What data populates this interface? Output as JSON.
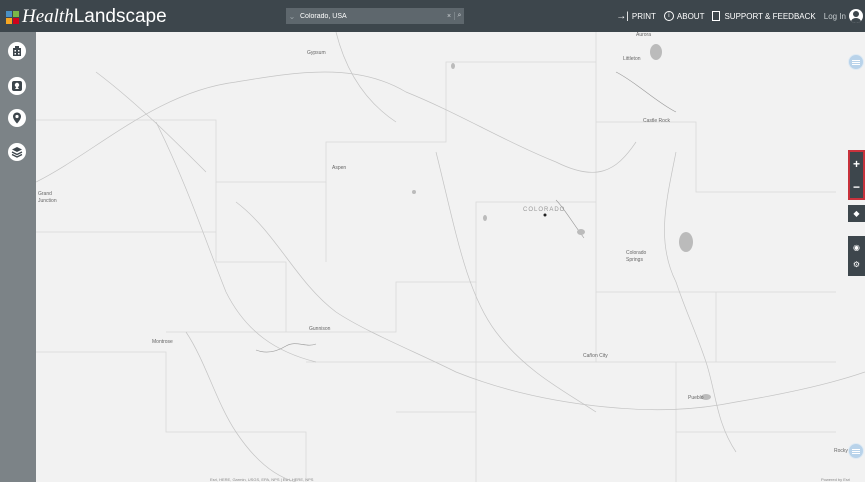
{
  "app": {
    "name_italic": "Health",
    "name_regular": "Landscape"
  },
  "brand_colors": [
    "#4a90c4",
    "#7ab648",
    "#f5a623",
    "#d0021b"
  ],
  "search": {
    "value": "Colorado, USA",
    "caret": "⌄",
    "clear": "×",
    "go": "⌕"
  },
  "nav": {
    "print": {
      "glyph": "→|",
      "label": "PRINT"
    },
    "about": {
      "glyph": "i",
      "label": "ABOUT"
    },
    "support": {
      "label": "SUPPORT & FEEDBACK"
    },
    "login": "Log In"
  },
  "sidebar": {
    "items": [
      {
        "icon": "building-icon"
      },
      {
        "icon": "map-marker-square-icon"
      },
      {
        "icon": "location-pin-icon"
      },
      {
        "icon": "layers-icon"
      }
    ]
  },
  "map": {
    "state_label": "COLORADO",
    "places": {
      "aurora": "Aurora",
      "littleton": "Littleton",
      "castle_rock": "Castle Rock",
      "gypsum": "Gypsum",
      "aspen": "Aspen",
      "grand_junction_1": "Grand",
      "grand_junction_2": "Junction",
      "colorado_springs_1": "Colorado",
      "colorado_springs_2": "Springs",
      "gunnison": "Gunnison",
      "montrose": "Montrose",
      "canon_city": "Cañon City",
      "pueblo": "Pueblo",
      "rocky_ford": "Rocky"
    },
    "attribution_left": "Esri, HERE, Garmin, USGS, EPA, NPS | Esri, HERE, NPS",
    "attribution_right": "Powered by Esri"
  },
  "controls": {
    "zoom_in": "+",
    "zoom_out": "−",
    "locate": "◆",
    "basemap": "◉",
    "settings": "⚙"
  }
}
